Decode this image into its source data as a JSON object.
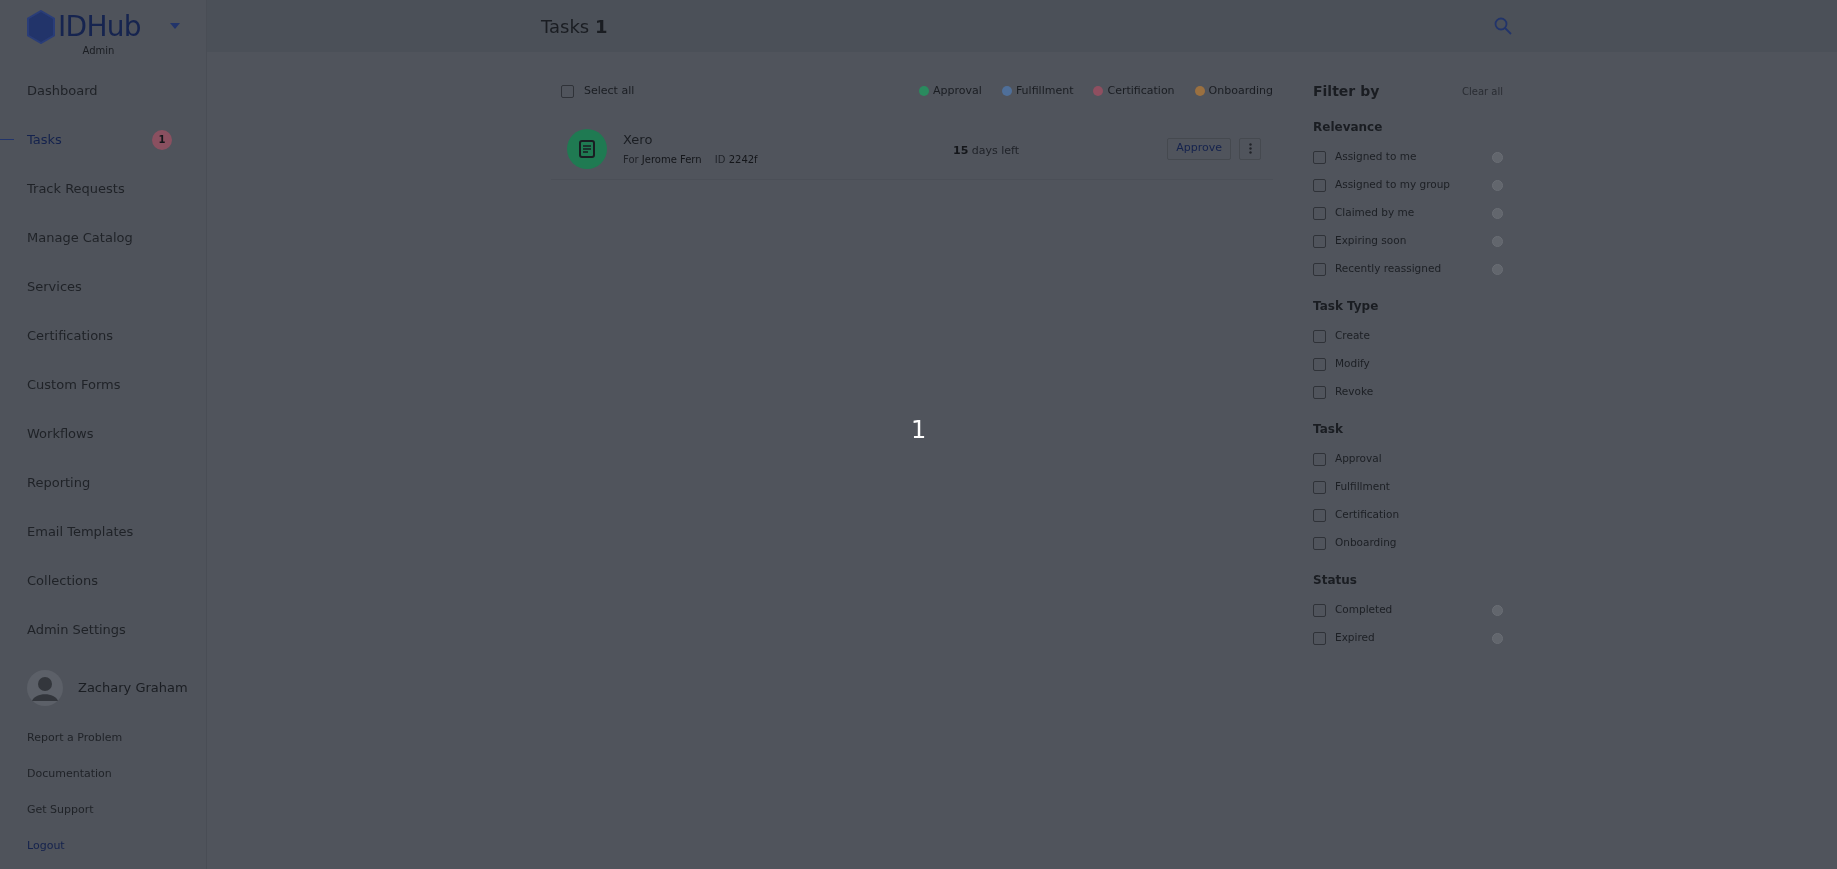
{
  "app": {
    "logo": "IDHub",
    "role": "Admin"
  },
  "sidebar": {
    "items": [
      {
        "label": "Dashboard",
        "selected": false
      },
      {
        "label": "Tasks",
        "selected": true,
        "badge": "1"
      },
      {
        "label": "Track Requests",
        "selected": false
      },
      {
        "label": "Manage Catalog",
        "selected": false
      },
      {
        "label": "Services",
        "selected": false
      },
      {
        "label": "Certifications",
        "selected": false
      },
      {
        "label": "Custom Forms",
        "selected": false
      },
      {
        "label": "Workflows",
        "selected": false
      },
      {
        "label": "Reporting",
        "selected": false
      },
      {
        "label": "Email Templates",
        "selected": false
      },
      {
        "label": "Collections",
        "selected": false
      },
      {
        "label": "Admin Settings",
        "selected": false
      }
    ],
    "user": {
      "name": "Zachary Graham"
    },
    "links": [
      {
        "label": "Report a Problem",
        "active": false
      },
      {
        "label": "Documentation",
        "active": false
      },
      {
        "label": "Get Support",
        "active": false
      },
      {
        "label": "Logout",
        "active": true
      }
    ]
  },
  "header": {
    "title": "Tasks",
    "count": "1"
  },
  "toolbar": {
    "select_all": {
      "label": "Select all",
      "checked": false
    },
    "legend": [
      {
        "label": "Approval",
        "color": "#2a8a5e"
      },
      {
        "label": "Fulfillment",
        "color": "#4f6f99"
      },
      {
        "label": "Certification",
        "color": "#8f4f60"
      },
      {
        "label": "Onboarding",
        "color": "#9a7040"
      }
    ]
  },
  "tasks": [
    {
      "name": "Xero",
      "for_label": "For",
      "for": "Jerome Fern",
      "id_label": "ID",
      "id": "2242f",
      "days": "15",
      "days_label": "days left",
      "action": "Approve"
    }
  ],
  "filters": {
    "title": "Filter by",
    "clear": "Clear all",
    "groups": [
      {
        "heading": "Relevance",
        "options": [
          {
            "label": "Assigned to me",
            "checked": false,
            "info": true
          },
          {
            "label": "Assigned to my group",
            "checked": false,
            "info": true
          },
          {
            "label": "Claimed by me",
            "checked": false,
            "info": true
          },
          {
            "label": "Expiring soon",
            "checked": false,
            "info": true
          },
          {
            "label": "Recently reassigned",
            "checked": false,
            "info": true
          }
        ]
      },
      {
        "heading": "Task Type",
        "options": [
          {
            "label": "Create",
            "checked": false,
            "info": false
          },
          {
            "label": "Modify",
            "checked": false,
            "info": false
          },
          {
            "label": "Revoke",
            "checked": false,
            "info": false
          }
        ]
      },
      {
        "heading": "Task",
        "options": [
          {
            "label": "Approval",
            "checked": false,
            "info": false
          },
          {
            "label": "Fulfillment",
            "checked": false,
            "info": false
          },
          {
            "label": "Certification",
            "checked": false,
            "info": false
          },
          {
            "label": "Onboarding",
            "checked": false,
            "info": false
          }
        ]
      },
      {
        "heading": "Status",
        "options": [
          {
            "label": "Completed",
            "checked": false,
            "info": true
          },
          {
            "label": "Expired",
            "checked": false,
            "info": true
          }
        ]
      }
    ]
  },
  "overlay": {
    "text": "1"
  }
}
